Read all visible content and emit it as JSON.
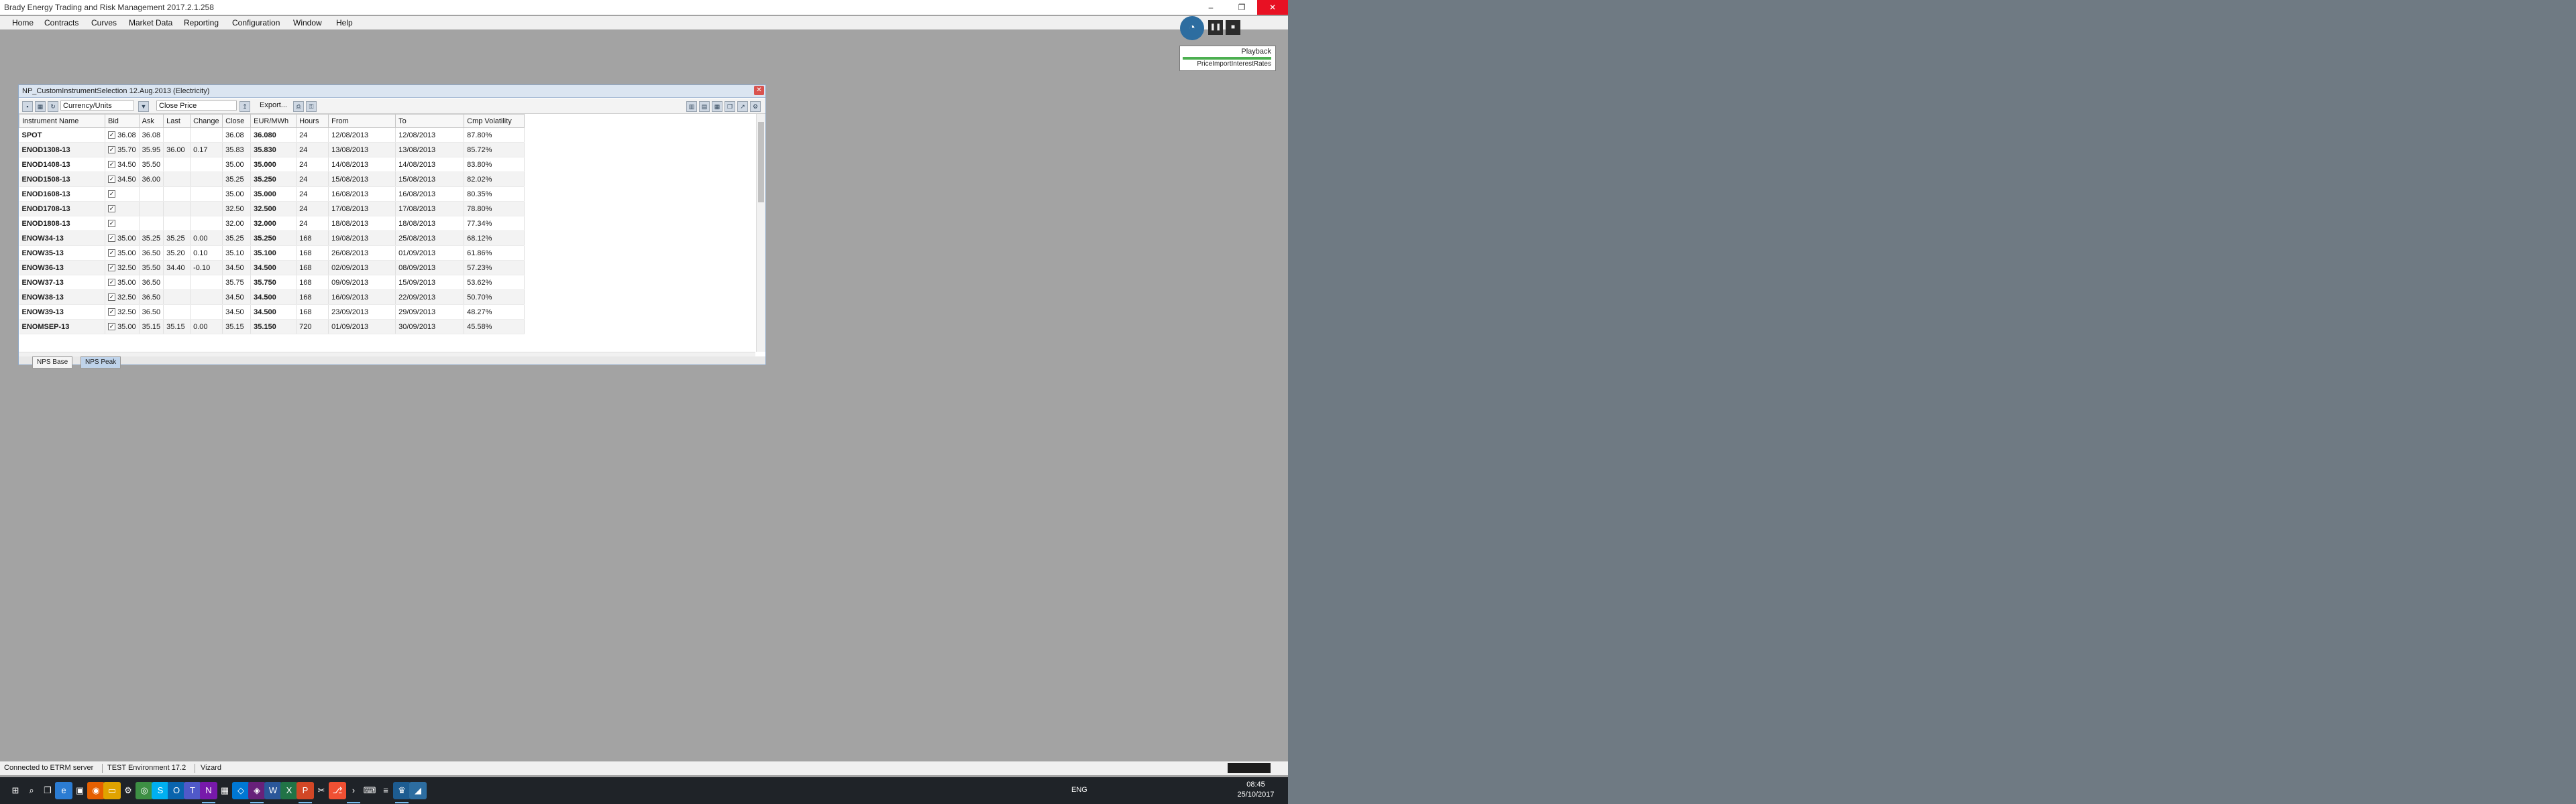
{
  "app": {
    "title": "Brady Energy Trading and Risk Management 2017.2.1.258",
    "window_buttons": [
      "–",
      "❐",
      "✕"
    ]
  },
  "menu": [
    "Home",
    "Contracts",
    "Curves",
    "Market Data",
    "Reporting",
    "Configuration",
    "Window",
    "Help"
  ],
  "playback": {
    "label": "Playback",
    "sub": "PriceImportInterestRates",
    "progress": 1.0
  },
  "inner_window": {
    "title": "NP_CustomInstrumentSelection 12.Aug.2013 (Electricity)",
    "close_label": "✕",
    "toolbar": {
      "currency_units": "Currency/Units",
      "close_price": "Close Price",
      "export": "Export..."
    },
    "columns": [
      "Instrument Name",
      "Bid",
      "Ask",
      "Last",
      "Change",
      "Close",
      "EUR/MWh",
      "Hours",
      "From",
      "To",
      "Cmp Volatility"
    ],
    "rows": [
      {
        "name": "SPOT",
        "bid": "36.08",
        "ask": "36.08",
        "last": "",
        "change": "",
        "close": "36.08",
        "price": "36.080",
        "hours": "24",
        "from": "12/08/2013",
        "to": "12/08/2013",
        "vol": "87.80%"
      },
      {
        "name": "ENOD1308-13",
        "bid": "35.70",
        "ask": "35.95",
        "last": "36.00",
        "change": "0.17",
        "close": "35.83",
        "price": "35.830",
        "hours": "24",
        "from": "13/08/2013",
        "to": "13/08/2013",
        "vol": "85.72%"
      },
      {
        "name": "ENOD1408-13",
        "bid": "34.50",
        "ask": "35.50",
        "last": "",
        "change": "",
        "close": "35.00",
        "price": "35.000",
        "hours": "24",
        "from": "14/08/2013",
        "to": "14/08/2013",
        "vol": "83.80%"
      },
      {
        "name": "ENOD1508-13",
        "bid": "34.50",
        "ask": "36.00",
        "last": "",
        "change": "",
        "close": "35.25",
        "price": "35.250",
        "hours": "24",
        "from": "15/08/2013",
        "to": "15/08/2013",
        "vol": "82.02%"
      },
      {
        "name": "ENOD1608-13",
        "bid": "",
        "ask": "",
        "last": "",
        "change": "",
        "close": "35.00",
        "price": "35.000",
        "hours": "24",
        "from": "16/08/2013",
        "to": "16/08/2013",
        "vol": "80.35%"
      },
      {
        "name": "ENOD1708-13",
        "bid": "",
        "ask": "",
        "last": "",
        "change": "",
        "close": "32.50",
        "price": "32.500",
        "hours": "24",
        "from": "17/08/2013",
        "to": "17/08/2013",
        "vol": "78.80%"
      },
      {
        "name": "ENOD1808-13",
        "bid": "",
        "ask": "",
        "last": "",
        "change": "",
        "close": "32.00",
        "price": "32.000",
        "hours": "24",
        "from": "18/08/2013",
        "to": "18/08/2013",
        "vol": "77.34%"
      },
      {
        "name": "ENOW34-13",
        "bid": "35.00",
        "ask": "35.25",
        "last": "35.25",
        "change": "0.00",
        "close": "35.25",
        "price": "35.250",
        "hours": "168",
        "from": "19/08/2013",
        "to": "25/08/2013",
        "vol": "68.12%"
      },
      {
        "name": "ENOW35-13",
        "bid": "35.00",
        "ask": "36.50",
        "last": "35.20",
        "change": "0.10",
        "close": "35.10",
        "price": "35.100",
        "hours": "168",
        "from": "26/08/2013",
        "to": "01/09/2013",
        "vol": "61.86%"
      },
      {
        "name": "ENOW36-13",
        "bid": "32.50",
        "ask": "35.50",
        "last": "34.40",
        "change": "-0.10",
        "close": "34.50",
        "price": "34.500",
        "hours": "168",
        "from": "02/09/2013",
        "to": "08/09/2013",
        "vol": "57.23%"
      },
      {
        "name": "ENOW37-13",
        "bid": "35.00",
        "ask": "36.50",
        "last": "",
        "change": "",
        "close": "35.75",
        "price": "35.750",
        "hours": "168",
        "from": "09/09/2013",
        "to": "15/09/2013",
        "vol": "53.62%"
      },
      {
        "name": "ENOW38-13",
        "bid": "32.50",
        "ask": "36.50",
        "last": "",
        "change": "",
        "close": "34.50",
        "price": "34.500",
        "hours": "168",
        "from": "16/09/2013",
        "to": "22/09/2013",
        "vol": "50.70%"
      },
      {
        "name": "ENOW39-13",
        "bid": "32.50",
        "ask": "36.50",
        "last": "",
        "change": "",
        "close": "34.50",
        "price": "34.500",
        "hours": "168",
        "from": "23/09/2013",
        "to": "29/09/2013",
        "vol": "48.27%"
      },
      {
        "name": "ENOMSEP-13",
        "bid": "35.00",
        "ask": "35.15",
        "last": "35.15",
        "change": "0.00",
        "close": "35.15",
        "price": "35.150",
        "hours": "720",
        "from": "01/09/2013",
        "to": "30/09/2013",
        "vol": "45.58%"
      }
    ],
    "tabs": [
      "NPS Base",
      "NPS Peak"
    ],
    "active_tab": 1
  },
  "status": {
    "connection": "Connected to ETRM server",
    "environment": "TEST Environment 17.2",
    "user": "Vizard"
  },
  "taskbar": {
    "lang": "ENG",
    "time": "08:45",
    "date": "25/10/2017",
    "apps": [
      "windows-start-icon",
      "search-icon",
      "task-view-icon",
      "edge-icon",
      "store-icon",
      "firefox-icon",
      "explorer-icon",
      "settings-icon",
      "chrome-icon",
      "skype-icon",
      "outlook-icon",
      "teams-icon",
      "onenote-icon",
      "calculator-icon",
      "vs-code-icon",
      "vs-icon",
      "word-icon",
      "excel-icon",
      "powerpoint-icon",
      "snipping-icon",
      "git-icon",
      "terminal-icon",
      "putty-icon",
      "notepad-icon",
      "royal-ts-icon",
      "etrm-icon"
    ]
  },
  "colors": {
    "accent": "#2d6da0",
    "close_red": "#e81123",
    "inner_caption": "#dbe5f1"
  }
}
